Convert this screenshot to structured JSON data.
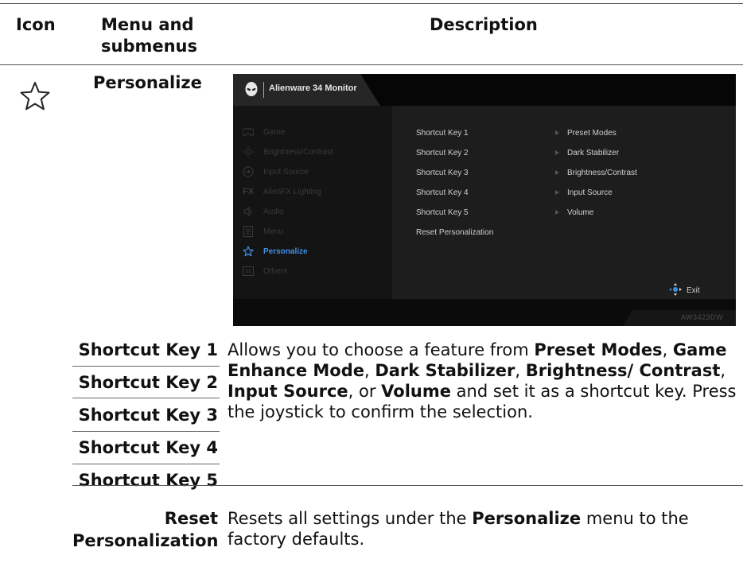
{
  "header": {
    "col_icon": "Icon",
    "col_menu_line1": "Menu and",
    "col_menu_line2": "submenus",
    "col_desc": "Description"
  },
  "section": {
    "name": "Personalize",
    "icon": "star-outline-icon"
  },
  "osd": {
    "title": "Alienware 34 Monitor",
    "model": "AW3423DW",
    "accent": "#3f8fe6",
    "menu": [
      {
        "icon": "gamepad-icon",
        "label": "Game"
      },
      {
        "icon": "brightness-icon",
        "label": "Brightness/Contrast"
      },
      {
        "icon": "input-source-icon",
        "label": "Input Source"
      },
      {
        "icon": "alienfx-icon",
        "label": "AlienFX Lighting"
      },
      {
        "icon": "audio-icon",
        "label": "Audio"
      },
      {
        "icon": "menu-icon",
        "label": "Menu"
      },
      {
        "icon": "star-icon",
        "label": "Personalize"
      },
      {
        "icon": "others-icon",
        "label": "Others"
      }
    ],
    "submenu": [
      {
        "label": "Shortcut Key 1",
        "value": "Preset Modes"
      },
      {
        "label": "Shortcut Key 2",
        "value": "Dark Stabilizer"
      },
      {
        "label": "Shortcut Key 3",
        "value": "Brightness/Contrast"
      },
      {
        "label": "Shortcut Key 4",
        "value": "Input Source"
      },
      {
        "label": "Shortcut Key 5",
        "value": "Volume"
      },
      {
        "label": "Reset Personalization",
        "value": ""
      }
    ],
    "exit_label": "Exit"
  },
  "shortcut_keys": [
    "Shortcut Key 1",
    "Shortcut Key 2",
    "Shortcut Key 3",
    "Shortcut Key 4",
    "Shortcut Key 5"
  ],
  "shortcut_desc": {
    "t1": "Allows you to choose a feature from ",
    "b1": "Preset Modes",
    "t2": ", ",
    "b2": "Game Enhance Mode",
    "t3": ", ",
    "b3": "Dark Stabilizer",
    "t4": ", ",
    "b4": "Brightness/ Contrast",
    "t5": ", ",
    "b5": "Input Source",
    "t6": ", or ",
    "b6": "Volume",
    "t7": " and set it as a shortcut key. Press the joystick to confirm the selection."
  },
  "reset": {
    "label_line1": "Reset",
    "label_line2": "Personalization",
    "t1": "Resets all settings under the ",
    "b1": "Personalize",
    "t2": " menu to the factory defaults."
  }
}
